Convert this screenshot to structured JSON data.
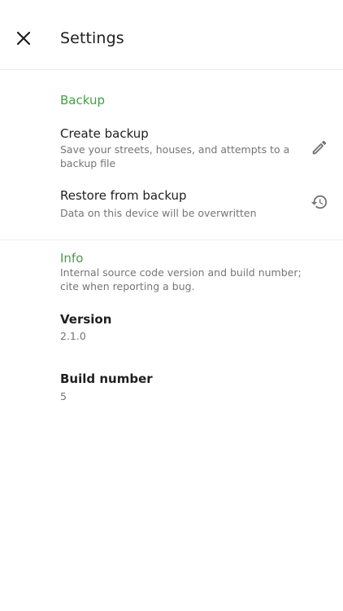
{
  "header": {
    "title": "Settings",
    "close_icon": "close-icon"
  },
  "backup": {
    "section_label": "Backup",
    "create": {
      "title": "Create backup",
      "subtitle": "Save your streets, houses, and attempts to a backup file",
      "icon": "pencil-icon"
    },
    "restore": {
      "title": "Restore from backup",
      "subtitle": "Data on this device will be overwritten",
      "icon": "history-icon"
    }
  },
  "info": {
    "section_label": "Info",
    "description": "Internal source code version and build number; cite when reporting a bug.",
    "version": {
      "title": "Version",
      "value": "2.1.0"
    },
    "build": {
      "title": "Build number",
      "value": "5"
    }
  },
  "colors": {
    "accent": "#43a047",
    "text_primary": "#1f1f1f",
    "text_secondary": "#757575",
    "icon": "#757575"
  }
}
